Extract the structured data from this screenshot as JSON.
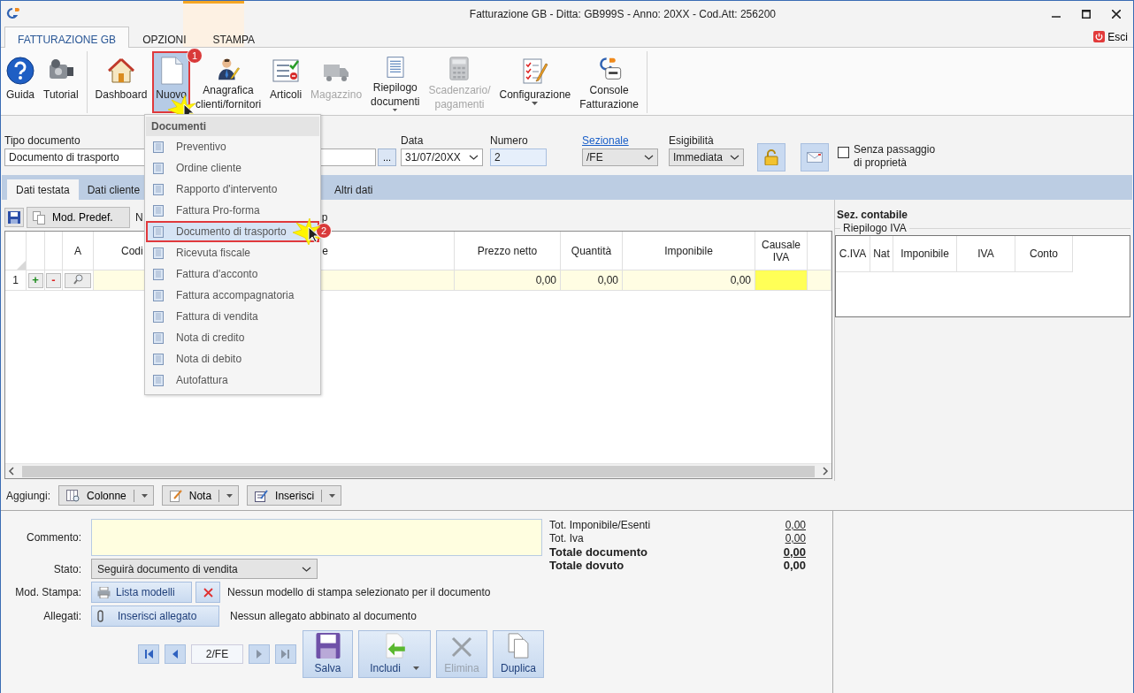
{
  "window": {
    "title": "Fatturazione GB - Ditta: GB999S - Anno: 20XX - Cod.Att: 256200"
  },
  "ribbon": {
    "tabs": [
      {
        "label": "FATTURAZIONE GB",
        "selected": true
      },
      {
        "label": "OPZIONI",
        "selected": false
      },
      {
        "label": "STAMPA",
        "selected": false
      }
    ],
    "exit": "Esci",
    "groups": [
      {
        "buttons": [
          {
            "label": "Guida",
            "disabled": false,
            "highlighted": false,
            "dropdown": false
          },
          {
            "label": "Tutorial",
            "disabled": false,
            "highlighted": false,
            "dropdown": false
          }
        ]
      },
      {
        "buttons": [
          {
            "label": "Dashboard",
            "disabled": false,
            "highlighted": false,
            "dropdown": false
          },
          {
            "label": "Nuovo",
            "disabled": false,
            "highlighted": true,
            "dropdown": false,
            "badge": "1"
          },
          {
            "label": "Anagrafica\nclienti/fornitori",
            "disabled": false,
            "highlighted": false,
            "dropdown": false
          },
          {
            "label": "Articoli",
            "disabled": false,
            "highlighted": false,
            "dropdown": false
          },
          {
            "label": "Magazzino",
            "disabled": true,
            "highlighted": false,
            "dropdown": false
          },
          {
            "label": "Riepilogo\ndocumenti",
            "disabled": false,
            "highlighted": false,
            "dropdown": true
          },
          {
            "label": "Scadenzario/\npagamenti",
            "disabled": true,
            "highlighted": false,
            "dropdown": false
          },
          {
            "label": "Configurazione",
            "disabled": false,
            "highlighted": false,
            "dropdown": true
          },
          {
            "label": "Console\nFatturazione",
            "disabled": false,
            "highlighted": false,
            "dropdown": false
          }
        ]
      }
    ]
  },
  "menu": {
    "header": "Documenti",
    "items": [
      {
        "label": "Preventivo",
        "selected": false
      },
      {
        "label": "Ordine cliente",
        "selected": false
      },
      {
        "label": "Rapporto d'intervento",
        "selected": false
      },
      {
        "label": "Fattura Pro-forma",
        "selected": false
      },
      {
        "label": "Documento di trasporto",
        "selected": true,
        "badge": "2"
      },
      {
        "label": "Ricevuta fiscale",
        "selected": false
      },
      {
        "label": "Fattura d'acconto",
        "selected": false
      },
      {
        "label": "Fattura accompagnatoria",
        "selected": false
      },
      {
        "label": "Fattura di vendita",
        "selected": false
      },
      {
        "label": "Nota di credito",
        "selected": false
      },
      {
        "label": "Nota di debito",
        "selected": false
      },
      {
        "label": "Autofattura",
        "selected": false
      }
    ]
  },
  "header_form": {
    "tipo_documento": {
      "label": "Tipo documento",
      "value": "Documento di trasporto",
      "browse": "..."
    },
    "data": {
      "label": "Data",
      "value": "31/07/20XX"
    },
    "numero": {
      "label": "Numero",
      "value": "2"
    },
    "sezionale": {
      "label": "Sezionale",
      "value": "/FE"
    },
    "esigibilita": {
      "label": "Esigibilità",
      "value": "Immediata"
    },
    "senza_passaggio": {
      "label": "Senza passaggio\ndi proprietà",
      "checked": false
    }
  },
  "tabs": [
    {
      "label": "Dati testata",
      "selected": true
    },
    {
      "label": "Dati cliente",
      "selected": false
    },
    {
      "label": "Altri dati",
      "selected": false
    }
  ],
  "grid_toolbar": {
    "button": "Mod. Predef.",
    "fragment_left": "N",
    "fragment_right": "p"
  },
  "table": {
    "columns": [
      "A",
      "Codi",
      "e",
      "Prezzo netto",
      "Quantità",
      "Imponibile",
      "Causale\nIVA"
    ],
    "rows": [
      {
        "number": "1",
        "add": "+",
        "remove": "-",
        "cells": [
          "",
          "",
          "",
          "0,00",
          "0,00",
          "0,00",
          ""
        ]
      }
    ]
  },
  "side": {
    "title": "Sez. contabile",
    "group": "Riepilogo IVA",
    "columns": [
      "C.IVA",
      "Nat",
      "Imponibile",
      "IVA",
      "Conto"
    ]
  },
  "aggiungi": {
    "label": "Aggiungi:",
    "buttons": [
      "Colonne",
      "Nota",
      "Inserisci"
    ]
  },
  "bottom": {
    "commento": "Commento:",
    "stato_label": "Stato:",
    "stato": "Seguirà documento di vendita",
    "stampa_label": "Mod. Stampa:",
    "stampa_button": "Lista modelli",
    "stampa_text": "Nessun modello di stampa selezionato per il documento",
    "allegati_label": "Allegati:",
    "allegati_button": "Inserisci allegato",
    "allegati_text": "Nessun allegato abbinato al documento",
    "pager": "2/FE",
    "actions": [
      {
        "label": "Salva",
        "disabled": false
      },
      {
        "label": "Includi",
        "disabled": false
      },
      {
        "label": "Elimina",
        "disabled": true
      },
      {
        "label": "Duplica",
        "disabled": false
      }
    ],
    "totals": [
      {
        "label": "Tot. Imponibile/Esenti",
        "value": "0,00",
        "kind": "subtotal"
      },
      {
        "label": "Tot. Iva",
        "value": "0,00",
        "kind": "subtotal"
      },
      {
        "label": "Totale documento",
        "value": "0,00",
        "kind": "total"
      },
      {
        "label": "Totale dovuto",
        "value": "0,00",
        "kind": "due"
      }
    ]
  }
}
